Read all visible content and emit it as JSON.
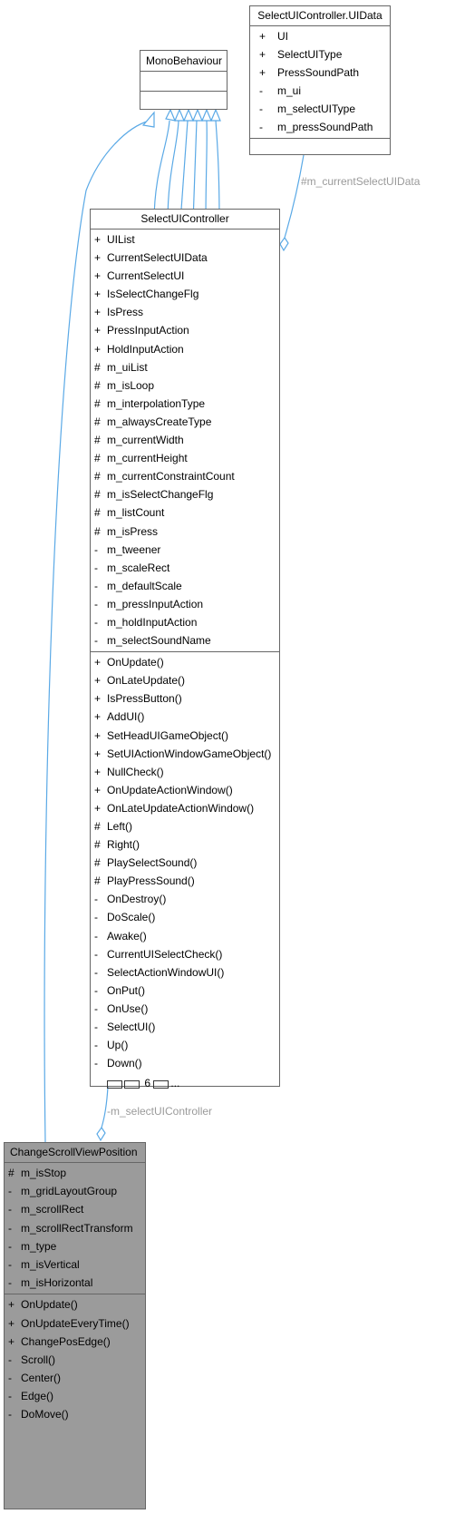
{
  "classes": {
    "uidata": {
      "title": "SelectUIController.UIData",
      "attributes": [
        {
          "vis": "+",
          "name": "UI"
        },
        {
          "vis": "+",
          "name": "SelectUIType"
        },
        {
          "vis": "+",
          "name": "PressSoundPath"
        },
        {
          "vis": "-",
          "name": "m_ui"
        },
        {
          "vis": "-",
          "name": "m_selectUIType"
        },
        {
          "vis": "-",
          "name": "m_pressSoundPath"
        }
      ]
    },
    "mono": {
      "title": "MonoBehaviour"
    },
    "ctrl": {
      "title": "SelectUIController",
      "attributes": [
        {
          "vis": "+",
          "name": "UIList"
        },
        {
          "vis": "+",
          "name": "CurrentSelectUIData"
        },
        {
          "vis": "+",
          "name": "CurrentSelectUI"
        },
        {
          "vis": "+",
          "name": "IsSelectChangeFlg"
        },
        {
          "vis": "+",
          "name": "IsPress"
        },
        {
          "vis": "+",
          "name": "PressInputAction"
        },
        {
          "vis": "+",
          "name": "HoldInputAction"
        },
        {
          "vis": "#",
          "name": "m_uiList"
        },
        {
          "vis": "#",
          "name": "m_isLoop"
        },
        {
          "vis": "#",
          "name": "m_interpolationType"
        },
        {
          "vis": "#",
          "name": "m_alwaysCreateType"
        },
        {
          "vis": "#",
          "name": "m_currentWidth"
        },
        {
          "vis": "#",
          "name": "m_currentHeight"
        },
        {
          "vis": "#",
          "name": "m_currentConstraintCount"
        },
        {
          "vis": "#",
          "name": "m_isSelectChangeFlg"
        },
        {
          "vis": "#",
          "name": "m_listCount"
        },
        {
          "vis": "#",
          "name": "m_isPress"
        },
        {
          "vis": "-",
          "name": "m_tweener"
        },
        {
          "vis": "-",
          "name": "m_scaleRect"
        },
        {
          "vis": "-",
          "name": "m_defaultScale"
        },
        {
          "vis": "-",
          "name": "m_pressInputAction"
        },
        {
          "vis": "-",
          "name": "m_holdInputAction"
        },
        {
          "vis": "-",
          "name": "m_selectSoundName"
        }
      ],
      "methods": [
        {
          "vis": "+",
          "name": "OnUpdate()"
        },
        {
          "vis": "+",
          "name": "OnLateUpdate()"
        },
        {
          "vis": "+",
          "name": "IsPressButton()"
        },
        {
          "vis": "+",
          "name": "AddUI()"
        },
        {
          "vis": "+",
          "name": "SetHeadUIGameObject()"
        },
        {
          "vis": "+",
          "name": "SetUIActionWindowGameObject()"
        },
        {
          "vis": "+",
          "name": "NullCheck()"
        },
        {
          "vis": "+",
          "name": "OnUpdateActionWindow()"
        },
        {
          "vis": "+",
          "name": "OnLateUpdateActionWindow()"
        },
        {
          "vis": "#",
          "name": "Left()"
        },
        {
          "vis": "#",
          "name": "Right()"
        },
        {
          "vis": "#",
          "name": "PlaySelectSound()"
        },
        {
          "vis": "#",
          "name": "PlayPressSound()"
        },
        {
          "vis": "-",
          "name": "OnDestroy()"
        },
        {
          "vis": "-",
          "name": "DoScale()"
        },
        {
          "vis": "-",
          "name": "Awake()"
        },
        {
          "vis": "-",
          "name": "CurrentUISelectCheck()"
        },
        {
          "vis": "-",
          "name": "SelectActionWindowUI()"
        },
        {
          "vis": "-",
          "name": "OnPut()"
        },
        {
          "vis": "-",
          "name": "OnUse()"
        },
        {
          "vis": "-",
          "name": "SelectUI()"
        },
        {
          "vis": "-",
          "name": "Up()"
        },
        {
          "vis": "-",
          "name": "Down()"
        }
      ],
      "more_count": "6",
      "more_ellipsis": "..."
    },
    "scroll": {
      "title": "ChangeScrollViewPosition",
      "attributes": [
        {
          "vis": "#",
          "name": "m_isStop"
        },
        {
          "vis": "-",
          "name": "m_gridLayoutGroup"
        },
        {
          "vis": "-",
          "name": "m_scrollRect"
        },
        {
          "vis": "-",
          "name": "m_scrollRectTransform"
        },
        {
          "vis": "-",
          "name": "m_type"
        },
        {
          "vis": "-",
          "name": "m_isVertical"
        },
        {
          "vis": "-",
          "name": "m_isHorizontal"
        }
      ],
      "methods": [
        {
          "vis": "+",
          "name": "OnUpdate()"
        },
        {
          "vis": "+",
          "name": "OnUpdateEveryTime()"
        },
        {
          "vis": "+",
          "name": "ChangePosEdge()"
        },
        {
          "vis": "-",
          "name": "Scroll()"
        },
        {
          "vis": "-",
          "name": "Center()"
        },
        {
          "vis": "-",
          "name": "Edge()"
        },
        {
          "vis": "-",
          "name": "DoMove()"
        }
      ]
    }
  },
  "edge_labels": {
    "uidata_to_ctrl": "#m_currentSelectUIData",
    "ctrl_to_scroll": "-m_selectUIController"
  },
  "colors": {
    "edge": "#5aa9e6",
    "box_border": "#666666",
    "highlight_box": "#9b9b9b",
    "edge_label": "#9a9a9a"
  }
}
